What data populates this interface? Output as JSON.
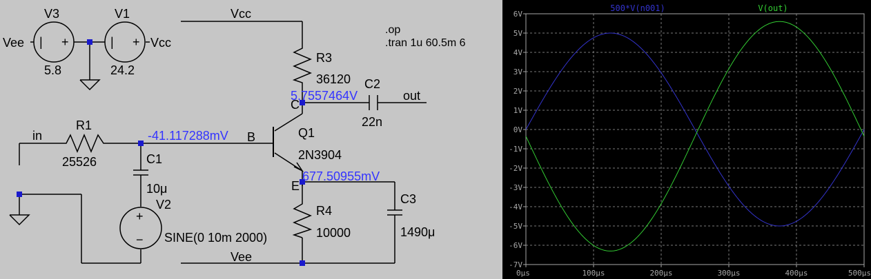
{
  "schematic": {
    "v3": {
      "name": "V3",
      "value": "5.8"
    },
    "v1": {
      "name": "V1",
      "value": "24.2"
    },
    "v2": {
      "name": "V2",
      "value": "SINE(0 10m 2000)"
    },
    "r1": {
      "name": "R1",
      "value": "25526"
    },
    "r3": {
      "name": "R3",
      "value": "36120"
    },
    "r4": {
      "name": "R4",
      "value": "10000"
    },
    "c1": {
      "name": "C1",
      "value": "10μ"
    },
    "c2": {
      "name": "C2",
      "value": "22n"
    },
    "c3": {
      "name": "C3",
      "value": "1490μ"
    },
    "q1": {
      "name": "Q1",
      "model": "2N3904",
      "pin_c": "C",
      "pin_b": "B",
      "pin_e": "E"
    },
    "nets": {
      "vee": "Vee",
      "vcc": "Vcc",
      "in": "in",
      "out": "out",
      "vee_left": "Vee",
      "vcc_right": "Vcc",
      "vcc_top": "Vcc",
      "vee_bottom": "Vee"
    },
    "node_voltages": {
      "collector": "5.7557464V",
      "base": "-41.117288mV",
      "emitter": "677.50955mV"
    },
    "directives": [
      "op",
      ".tran 1u 60.5m 6"
    ],
    "plus_sign": "+",
    "minus_sign": "−",
    "bar_sign": "|"
  },
  "chart_data": {
    "type": "line",
    "x_unit": "µs",
    "xlim": [
      0,
      500
    ],
    "ylim": [
      -7,
      6
    ],
    "x_ticks": [
      "0µs",
      "100µs",
      "200µs",
      "300µs",
      "400µs",
      "500µs"
    ],
    "y_ticks": [
      "6V",
      "5V",
      "4V",
      "3V",
      "2V",
      "1V",
      "0V",
      "-1V",
      "-2V",
      "-3V",
      "-4V",
      "-5V",
      "-6V",
      "-7V"
    ],
    "grid": true,
    "series": [
      {
        "name": "500*V(n001)",
        "color": "#3333cc",
        "offset": 0.0,
        "amplitude": 5.0,
        "phase": 0
      },
      {
        "name": "V(out)",
        "color": "#33cc33",
        "offset": -0.35,
        "amplitude": 5.95,
        "phase": 180
      }
    ],
    "frequency_hz": 2000
  }
}
